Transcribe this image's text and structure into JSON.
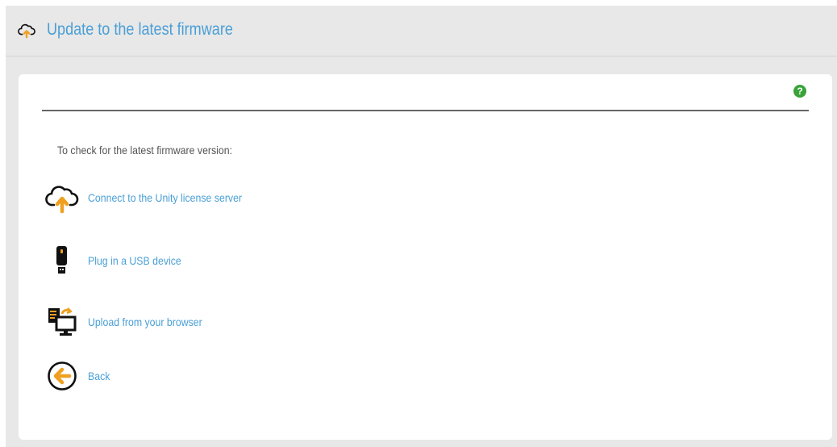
{
  "header": {
    "title": "Update to the latest firmware",
    "icon": "cloud-upload-icon"
  },
  "card": {
    "help_label": "?",
    "intro_text": "To check for the latest firmware version:",
    "options": [
      {
        "label": "Connect to the Unity license server",
        "icon": "cloud-upload-icon"
      },
      {
        "label": "Plug in a USB device",
        "icon": "usb-drive-icon"
      },
      {
        "label": "Upload from your browser",
        "icon": "upload-from-computer-icon"
      },
      {
        "label": "Back",
        "icon": "back-arrow-icon"
      }
    ]
  },
  "colors": {
    "link": "#4a9fd6",
    "accent_orange": "#f0a020",
    "help_green": "#3aa23a",
    "background": "#e8e8e8"
  }
}
